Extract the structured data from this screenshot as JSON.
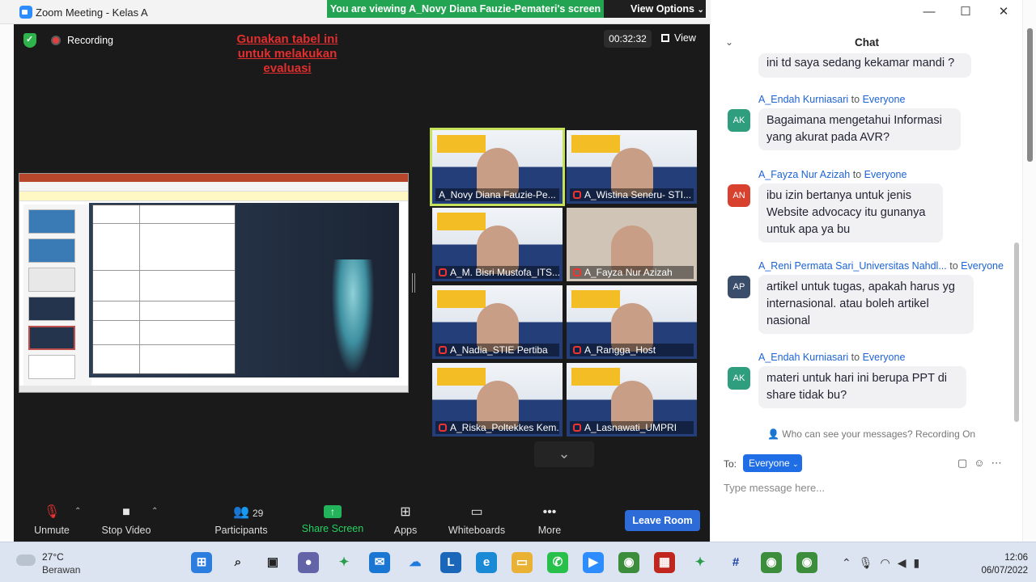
{
  "window": {
    "title": "Zoom Meeting - Kelas A",
    "controls": [
      "—",
      "☐",
      "✕"
    ]
  },
  "banner": {
    "viewing": "You are viewing A_Novy Diana Fauzie-Pemateri's screen",
    "view_options": "View Options"
  },
  "meeting_top": {
    "recording": "Recording",
    "timer": "00:32:32",
    "view": "View"
  },
  "shared_slide": {
    "caption": "Gunakan tabel ini untuk melakukan evaluasi"
  },
  "participants": [
    {
      "name": "A_Novy Diana Fauzie-Pe...",
      "muted": false
    },
    {
      "name": "A_Wistina Seneru- STI...",
      "muted": true
    },
    {
      "name": "A_M. Bisri Mustofa_ITS...",
      "muted": true
    },
    {
      "name": "A_Fayza Nur Azizah",
      "muted": true
    },
    {
      "name": "A_Nadia_STIE Pertiba",
      "muted": true
    },
    {
      "name": "A_Rangga_Host",
      "muted": true
    },
    {
      "name": "A_Riska_Poltekkes Kem...",
      "muted": true
    },
    {
      "name": "A_Lasnawati_UMPRI",
      "muted": true
    }
  ],
  "controls": {
    "unmute": "Unmute",
    "stop_video": "Stop Video",
    "participants": "Participants",
    "participants_count": "29",
    "share_screen": "Share Screen",
    "apps": "Apps",
    "whiteboards": "Whiteboards",
    "more": "More",
    "leave": "Leave Room"
  },
  "chat": {
    "title": "Chat",
    "messages": [
      {
        "initials": "",
        "sender": "",
        "to": "",
        "text": "ini td saya sedang kekamar mandi ?"
      },
      {
        "initials": "AK",
        "sender": "A_Endah Kurniasari",
        "to": "Everyone",
        "text": "Bagaimana mengetahui Informasi yang akurat pada AVR?"
      },
      {
        "initials": "AN",
        "sender": "A_Fayza Nur Azizah",
        "to": "Everyone",
        "text": "ibu izin bertanya untuk jenis Website advocacy itu gunanya untuk apa ya bu"
      },
      {
        "initials": "AP",
        "sender": "A_Reni Permata Sari_Universitas Nahdl...",
        "to": "Everyone",
        "text": "artikel untuk tugas, apakah harus yg internasional. atau boleh artikel nasional"
      },
      {
        "initials": "AK",
        "sender": "A_Endah Kurniasari",
        "to": "Everyone",
        "text": "materi untuk hari ini berupa PPT di share tidak bu?"
      }
    ],
    "to_word": "to",
    "who_can_see": "Who can see your messages? Recording On",
    "to_label": "To:",
    "recipient": "Everyone",
    "input_placeholder": "Type message here...",
    "colors": {
      "AK": "#2e9e7e",
      "AN": "#d9412f",
      "AP": "#3a4d6a"
    }
  },
  "taskbar": {
    "temp": "27°C",
    "weather": "Berawan",
    "time": "12:06",
    "date": "06/07/2022"
  }
}
